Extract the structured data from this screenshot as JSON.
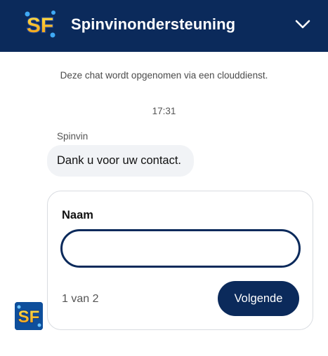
{
  "header": {
    "logo_icon": "sf-logo-icon",
    "logo_text": "SF",
    "title": "Spinvinondersteuning",
    "collapse_icon": "chevron-down-icon"
  },
  "chat": {
    "recording_notice": "Deze chat wordt opgenomen via een clouddienst.",
    "timestamp": "17:31",
    "sender_name": "Spinvin",
    "message": "Dank u voor uw contact."
  },
  "form": {
    "field_label": "Naam",
    "field_value": "",
    "step_indicator": "1 van 2",
    "next_label": "Volgende"
  },
  "avatar": {
    "icon": "sf-logo-icon",
    "text": "SF"
  },
  "colors": {
    "brand_navy": "#0b2a5b",
    "bubble_bg": "#f1f3f6",
    "logo_yellow": "#f6c21c",
    "logo_blue": "#1e78d6"
  }
}
